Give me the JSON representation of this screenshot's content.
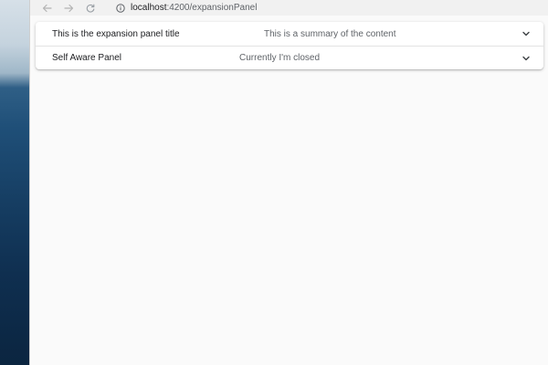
{
  "browser": {
    "url_host": "localhost",
    "url_path": ":4200/expansionPanel"
  },
  "accordion": {
    "panels": [
      {
        "title": "This is the expansion panel title",
        "description": "This is a summary of the content"
      },
      {
        "title": "Self Aware Panel",
        "description": "Currently I'm closed"
      }
    ]
  },
  "icons": {
    "back": "arrow-left-icon",
    "forward": "arrow-right-icon",
    "reload": "reload-icon",
    "info": "info-icon",
    "expand": "chevron-down-icon"
  },
  "colors": {
    "page_background": "#fafafa",
    "panel_background": "#ffffff",
    "title_text": "#202124",
    "description_text": "#5f6368"
  }
}
